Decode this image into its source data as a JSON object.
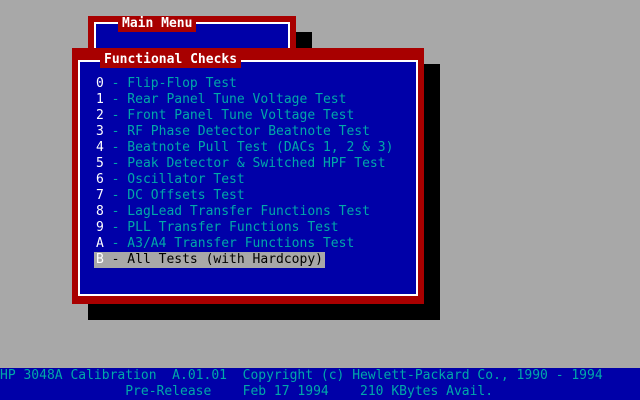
{
  "main_menu": {
    "title": "Main Menu"
  },
  "functional_checks": {
    "title": "Functional Checks",
    "items": [
      {
        "key": "0",
        "label": " - Flip-Flop Test"
      },
      {
        "key": "1",
        "label": " - Rear Panel Tune Voltage Test"
      },
      {
        "key": "2",
        "label": " - Front Panel Tune Voltage Test"
      },
      {
        "key": "3",
        "label": " - RF Phase Detector Beatnote Test"
      },
      {
        "key": "4",
        "label": " - Beatnote Pull Test (DACs 1, 2 & 3)"
      },
      {
        "key": "5",
        "label": " - Peak Detector & Switched HPF Test"
      },
      {
        "key": "6",
        "label": " - Oscillator Test"
      },
      {
        "key": "7",
        "label": " - DC Offsets Test"
      },
      {
        "key": "8",
        "label": " - LagLead Transfer Functions Test"
      },
      {
        "key": "9",
        "label": " - PLL Transfer Functions Test"
      },
      {
        "key": "A",
        "label": " - A3/A4 Transfer Functions Test"
      },
      {
        "key": "B",
        "label": " - All Tests (with Hardcopy)"
      }
    ],
    "selected_index": 11
  },
  "status_bar": {
    "line1": "HP 3048A Calibration  A.01.01  Copyright (c) Hewlett-Packard Co., 1990 - 1994",
    "line2": "                Pre-Release    Feb 17 1994    210 KBytes Avail."
  },
  "colors": {
    "desktop": "#a8a8a8",
    "window_frame": "#a80000",
    "window_body": "#0000a8",
    "item_text": "#00a8a8",
    "hotkey": "#ffffff",
    "selection_bg": "#a8a8a8"
  }
}
